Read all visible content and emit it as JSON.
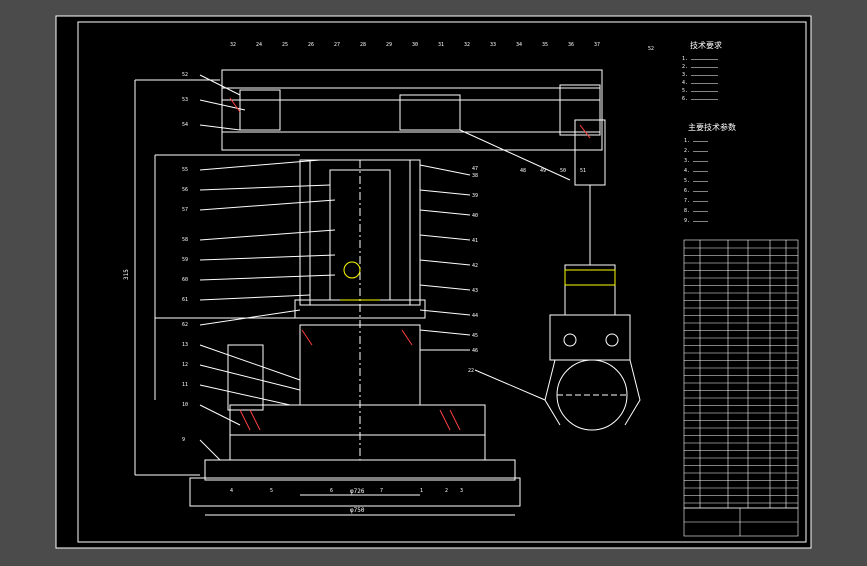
{
  "drawing": {
    "background_color": "#4b4b4b",
    "sheet_color": "#000000",
    "line_color": "#ffffff",
    "accent_color": "#ffff00",
    "hatch_color": "#ff4040",
    "tech_requirements_title": "技术要求",
    "main_params_title": "主要技术参数",
    "dims": {
      "total_height": "315",
      "base_width": "φ726",
      "base_width_2": "φ750"
    },
    "callouts_left": [
      "52",
      "53",
      "54",
      "55",
      "56",
      "57",
      "58",
      "59",
      "60",
      "61",
      "62",
      "13",
      "12",
      "11",
      "10",
      "9",
      "8",
      "7",
      "6",
      "5",
      "4",
      "3",
      "2",
      "1",
      "17",
      "15",
      "16"
    ],
    "callouts_top": [
      "32",
      "24",
      "25",
      "26",
      "27",
      "28",
      "29",
      "30",
      "31",
      "32",
      "33",
      "34",
      "35",
      "36",
      "37"
    ],
    "callouts_right": [
      "38",
      "39",
      "40",
      "41",
      "42",
      "43",
      "44",
      "45",
      "46",
      "47",
      "48",
      "49",
      "50",
      "51",
      "52"
    ],
    "callouts_bottom": [
      "4",
      "5",
      "6",
      "7",
      "1",
      "2",
      "3"
    ],
    "gripper_label": "22"
  }
}
